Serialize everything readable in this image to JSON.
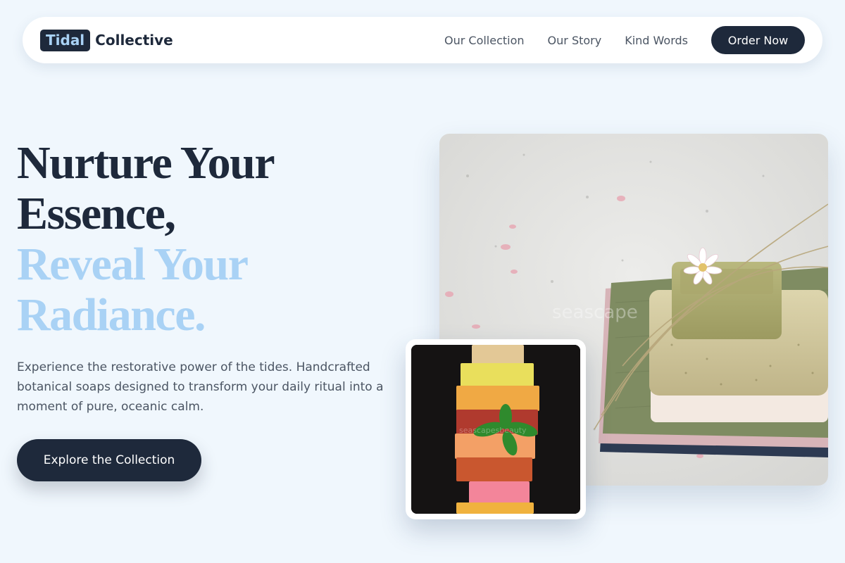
{
  "brand": {
    "badge": "Tidal",
    "name": "Collective"
  },
  "nav": {
    "links": [
      "Our Collection",
      "Our Story",
      "Kind Words"
    ],
    "cta": "Order Now"
  },
  "hero": {
    "line1": "Nurture Your",
    "line2": "Essence,",
    "line3": "Reveal Your",
    "line4": "Radiance.",
    "description": "Experience the restorative power of the tides. Handcrafted botanical soaps designed to transform your daily ritual into a moment of pure, oceanic calm.",
    "button": "Explore the Collection"
  },
  "images": {
    "main_watermark": "seascape",
    "small_watermark": "seascapesbeauty"
  },
  "colors": {
    "navy": "#1e293b",
    "accent": "#a9d2f5",
    "background": "#f0f7fd",
    "muted": "#4b5563"
  }
}
